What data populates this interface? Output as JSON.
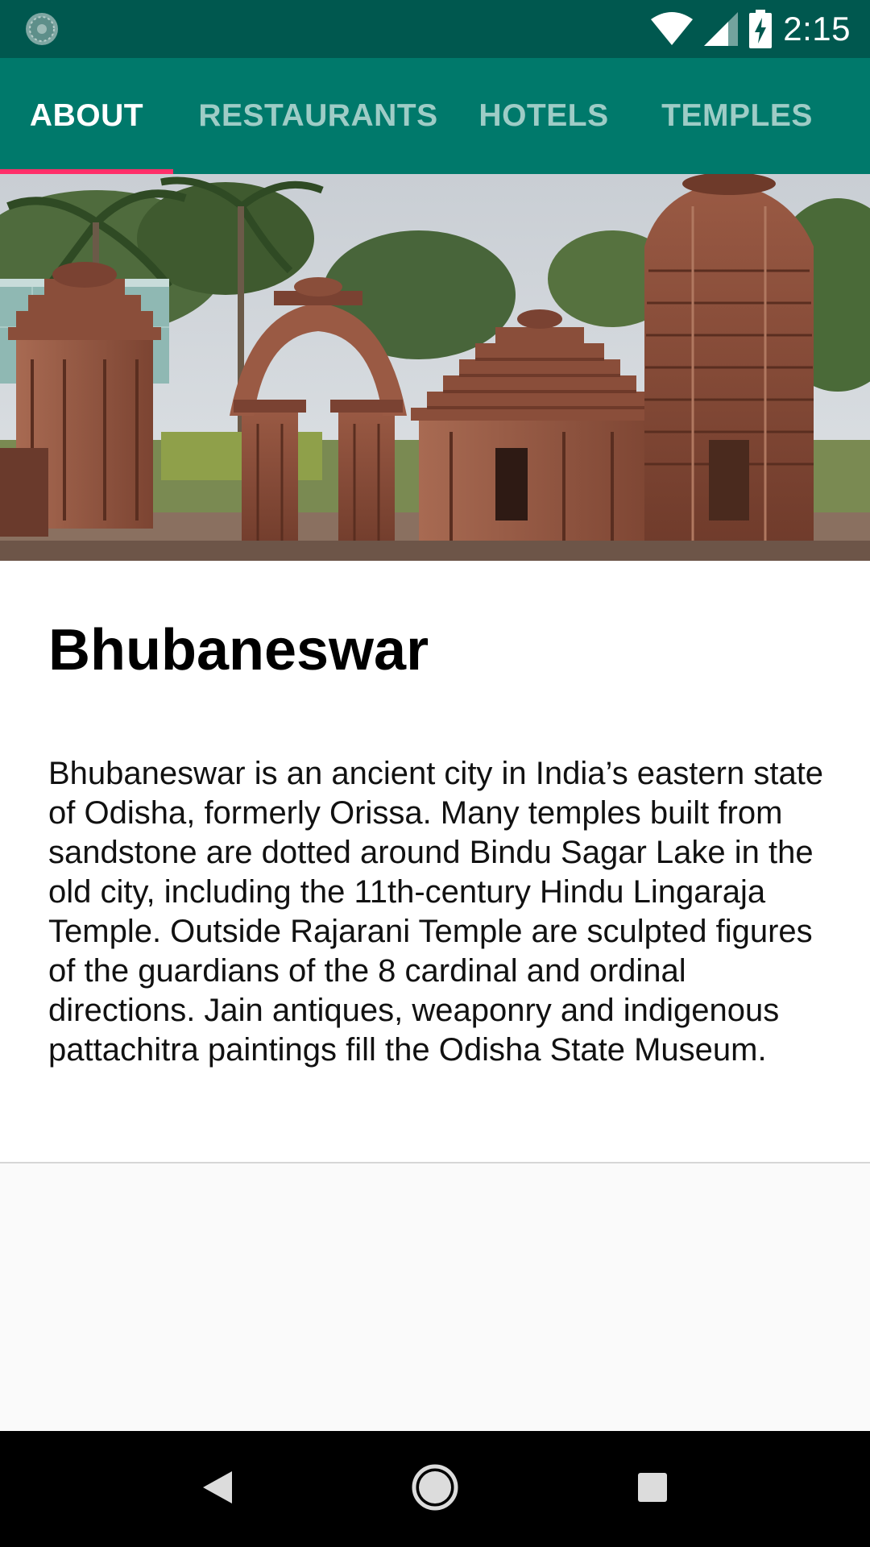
{
  "status_bar": {
    "time": "2:15",
    "icons": [
      "app-notification-icon",
      "wifi-icon",
      "cellular-signal-icon",
      "battery-charging-icon"
    ]
  },
  "tabs": [
    {
      "label": "ABOUT",
      "active": true
    },
    {
      "label": "RESTAURANTS",
      "active": false
    },
    {
      "label": "HOTELS",
      "active": false
    },
    {
      "label": "TEMPLES",
      "active": false
    }
  ],
  "hero": {
    "image": "temple-photo"
  },
  "content": {
    "title": "Bhubaneswar",
    "description": "Bhubaneswar is an ancient city in India’s eastern state of Odisha, formerly Orissa. Many temples built from sandstone are dotted around Bindu Sagar Lake in the old city, including the 11th-century Hindu Lingaraja Temple. Outside Rajarani Temple are sculpted figures of the guardians of the 8 cardinal and ordinal directions. Jain antiques, weaponry and indigenous pattachitra paintings fill the Odisha State Museum."
  },
  "nav_bar": {
    "icons": [
      "back-icon",
      "home-icon",
      "recents-icon"
    ]
  },
  "colors": {
    "status_bar": "#00584f",
    "tab_bar": "#00796b",
    "tab_indicator": "#ff2f6a",
    "background": "#fafafa"
  }
}
